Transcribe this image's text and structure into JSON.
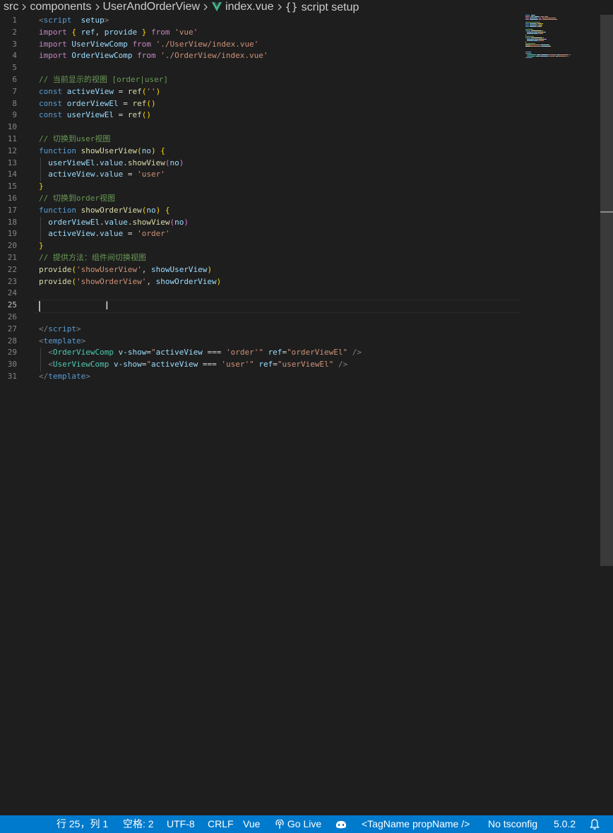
{
  "breadcrumb": {
    "items": [
      "src",
      "components",
      "UserAndOrderView",
      "index.vue",
      "script setup"
    ],
    "file_icon": "vue-icon",
    "symbol_icon": "braces-icon"
  },
  "editor": {
    "active_line": 25,
    "lines": [
      {
        "n": 1,
        "tokens": [
          [
            "t",
            "<"
          ],
          [
            "tag",
            "script"
          ],
          [
            "",
            "  "
          ],
          [
            "var",
            "setup"
          ],
          [
            "t",
            ">"
          ]
        ]
      },
      {
        "n": 2,
        "tokens": [
          [
            "kw",
            "import"
          ],
          [
            "",
            " "
          ],
          [
            "b1",
            "{"
          ],
          [
            "",
            " "
          ],
          [
            "var",
            "ref"
          ],
          [
            "",
            ", "
          ],
          [
            "var",
            "provide"
          ],
          [
            "",
            " "
          ],
          [
            "b1",
            "}"
          ],
          [
            "",
            " "
          ],
          [
            "kw",
            "from"
          ],
          [
            "",
            " "
          ],
          [
            "str",
            "'vue'"
          ]
        ]
      },
      {
        "n": 3,
        "tokens": [
          [
            "kw",
            "import"
          ],
          [
            "",
            " "
          ],
          [
            "var",
            "UserViewComp"
          ],
          [
            "",
            " "
          ],
          [
            "kw",
            "from"
          ],
          [
            "",
            " "
          ],
          [
            "str",
            "'./UserView/index.vue'"
          ]
        ]
      },
      {
        "n": 4,
        "tokens": [
          [
            "kw",
            "import"
          ],
          [
            "",
            " "
          ],
          [
            "var",
            "OrderViewComp"
          ],
          [
            "",
            " "
          ],
          [
            "kw",
            "from"
          ],
          [
            "",
            " "
          ],
          [
            "str",
            "'./OrderView/index.vue'"
          ]
        ]
      },
      {
        "n": 5,
        "tokens": []
      },
      {
        "n": 6,
        "tokens": [
          [
            "cm",
            "// 当前显示的视图 [order|user]"
          ]
        ]
      },
      {
        "n": 7,
        "tokens": [
          [
            "dk",
            "const"
          ],
          [
            "",
            " "
          ],
          [
            "var",
            "activeView"
          ],
          [
            "",
            " = "
          ],
          [
            "fn",
            "ref"
          ],
          [
            "b1",
            "("
          ],
          [
            "str",
            "''"
          ],
          [
            "b1",
            ")"
          ]
        ]
      },
      {
        "n": 8,
        "tokens": [
          [
            "dk",
            "const"
          ],
          [
            "",
            " "
          ],
          [
            "var",
            "orderViewEl"
          ],
          [
            "",
            " = "
          ],
          [
            "fn",
            "ref"
          ],
          [
            "b1",
            "()"
          ]
        ]
      },
      {
        "n": 9,
        "tokens": [
          [
            "dk",
            "const"
          ],
          [
            "",
            " "
          ],
          [
            "var",
            "userViewEl"
          ],
          [
            "",
            " = "
          ],
          [
            "fn",
            "ref"
          ],
          [
            "b1",
            "()"
          ]
        ]
      },
      {
        "n": 10,
        "tokens": []
      },
      {
        "n": 11,
        "tokens": [
          [
            "cm",
            "// 切换到user视图"
          ]
        ]
      },
      {
        "n": 12,
        "tokens": [
          [
            "dk",
            "function"
          ],
          [
            "",
            " "
          ],
          [
            "fn",
            "showUserView"
          ],
          [
            "b1",
            "("
          ],
          [
            "var",
            "no"
          ],
          [
            "b1",
            ")"
          ],
          [
            "",
            " "
          ],
          [
            "b1",
            "{"
          ]
        ]
      },
      {
        "n": 13,
        "tokens": [
          [
            "",
            "  "
          ],
          [
            "var",
            "userViewEl"
          ],
          [
            "",
            "."
          ],
          [
            "var",
            "value"
          ],
          [
            "",
            "."
          ],
          [
            "fn",
            "showView"
          ],
          [
            "b2",
            "("
          ],
          [
            "var",
            "no"
          ],
          [
            "b2",
            ")"
          ]
        ]
      },
      {
        "n": 14,
        "tokens": [
          [
            "",
            "  "
          ],
          [
            "var",
            "activeView"
          ],
          [
            "",
            "."
          ],
          [
            "var",
            "value"
          ],
          [
            "",
            " = "
          ],
          [
            "str",
            "'user'"
          ]
        ]
      },
      {
        "n": 15,
        "tokens": [
          [
            "b1",
            "}"
          ]
        ]
      },
      {
        "n": 16,
        "tokens": [
          [
            "cm",
            "// 切换到order视图"
          ]
        ]
      },
      {
        "n": 17,
        "tokens": [
          [
            "dk",
            "function"
          ],
          [
            "",
            " "
          ],
          [
            "fn",
            "showOrderView"
          ],
          [
            "b1",
            "("
          ],
          [
            "var",
            "no"
          ],
          [
            "b1",
            ")"
          ],
          [
            "",
            " "
          ],
          [
            "b1",
            "{"
          ]
        ]
      },
      {
        "n": 18,
        "tokens": [
          [
            "",
            "  "
          ],
          [
            "var",
            "orderViewEl"
          ],
          [
            "",
            "."
          ],
          [
            "var",
            "value"
          ],
          [
            "",
            "."
          ],
          [
            "fn",
            "showView"
          ],
          [
            "b2",
            "("
          ],
          [
            "var",
            "no"
          ],
          [
            "b2",
            ")"
          ]
        ]
      },
      {
        "n": 19,
        "tokens": [
          [
            "",
            "  "
          ],
          [
            "var",
            "activeView"
          ],
          [
            "",
            "."
          ],
          [
            "var",
            "value"
          ],
          [
            "",
            " = "
          ],
          [
            "str",
            "'order'"
          ]
        ]
      },
      {
        "n": 20,
        "tokens": [
          [
            "b1",
            "}"
          ]
        ]
      },
      {
        "n": 21,
        "tokens": [
          [
            "cm",
            "// 提供方法：组件间切换视图"
          ]
        ]
      },
      {
        "n": 22,
        "tokens": [
          [
            "fn",
            "provide"
          ],
          [
            "b1",
            "("
          ],
          [
            "str",
            "'showUserView'"
          ],
          [
            "",
            ", "
          ],
          [
            "var",
            "showUserView"
          ],
          [
            "b1",
            ")"
          ]
        ]
      },
      {
        "n": 23,
        "tokens": [
          [
            "fn",
            "provide"
          ],
          [
            "b1",
            "("
          ],
          [
            "str",
            "'showOrderView'"
          ],
          [
            "",
            ", "
          ],
          [
            "var",
            "showOrderView"
          ],
          [
            "b1",
            ")"
          ]
        ]
      },
      {
        "n": 24,
        "tokens": []
      },
      {
        "n": 25,
        "tokens": []
      },
      {
        "n": 26,
        "tokens": []
      },
      {
        "n": 27,
        "tokens": [
          [
            "t",
            "</"
          ],
          [
            "tag",
            "script"
          ],
          [
            "t",
            ">"
          ]
        ]
      },
      {
        "n": 28,
        "tokens": [
          [
            "t",
            "<"
          ],
          [
            "tag",
            "template"
          ],
          [
            "t",
            ">"
          ]
        ]
      },
      {
        "n": 29,
        "tokens": [
          [
            "",
            "  "
          ],
          [
            "t",
            "<"
          ],
          [
            "comp",
            "OrderViewComp"
          ],
          [
            "",
            " "
          ],
          [
            "attr",
            "v-show"
          ],
          [
            "",
            "="
          ],
          [
            "str",
            "\""
          ],
          [
            "var",
            "activeView"
          ],
          [
            "",
            " === "
          ],
          [
            "str",
            "'order'"
          ],
          [
            "str",
            "\""
          ],
          [
            "",
            " "
          ],
          [
            "attr",
            "ref"
          ],
          [
            "",
            "="
          ],
          [
            "str",
            "\"orderViewEl\""
          ],
          [
            "",
            " "
          ],
          [
            "t",
            "/>"
          ]
        ]
      },
      {
        "n": 30,
        "tokens": [
          [
            "",
            "  "
          ],
          [
            "t",
            "<"
          ],
          [
            "comp",
            "UserViewComp"
          ],
          [
            "",
            " "
          ],
          [
            "attr",
            "v-show"
          ],
          [
            "",
            "="
          ],
          [
            "str",
            "\""
          ],
          [
            "var",
            "activeView"
          ],
          [
            "",
            " === "
          ],
          [
            "str",
            "'user'"
          ],
          [
            "str",
            "\""
          ],
          [
            "",
            " "
          ],
          [
            "attr",
            "ref"
          ],
          [
            "",
            "="
          ],
          [
            "str",
            "\"userViewEl\""
          ],
          [
            "",
            " "
          ],
          [
            "t",
            "/>"
          ]
        ]
      },
      {
        "n": 31,
        "tokens": [
          [
            "t",
            "</"
          ],
          [
            "tag",
            "template"
          ],
          [
            "t",
            ">"
          ]
        ]
      }
    ]
  },
  "statusbar": {
    "position": "行 25，列 1",
    "indent": "空格: 2",
    "encoding": "UTF-8",
    "eol": "CRLF",
    "language": "Vue",
    "golive": "Go Live",
    "copilot_icon": "copilot-icon",
    "snippet": "<TagName propName />",
    "tsconfig": "No tsconfig",
    "version": "5.0.2",
    "bell_icon": "bell-icon"
  }
}
